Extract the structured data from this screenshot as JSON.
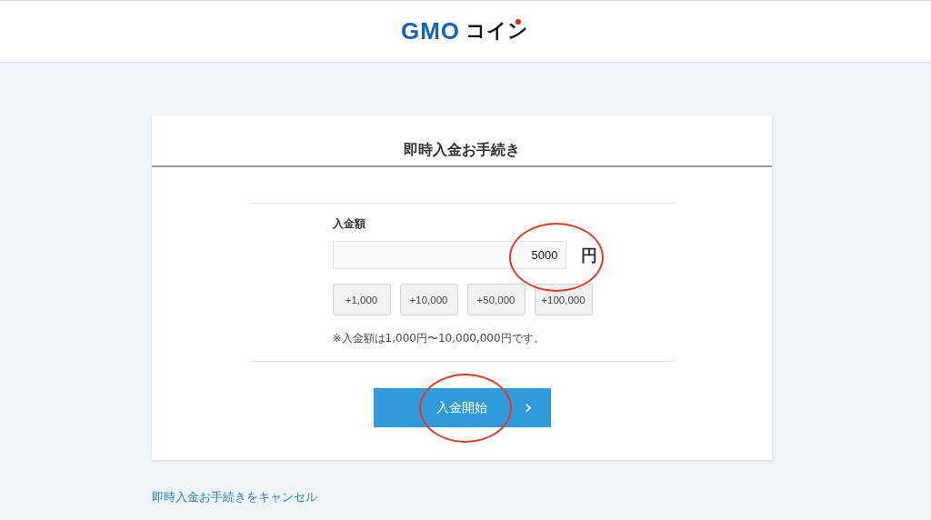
{
  "header": {
    "logo": {
      "latin": "GMO",
      "kana": "コイン"
    }
  },
  "card": {
    "title": "即時入金お手続き",
    "amount": {
      "label": "入金額",
      "value": "5000",
      "unit": "円"
    },
    "quick_buttons": [
      "+1,000",
      "+10,000",
      "+50,000",
      "+100,000"
    ],
    "note": "※入金額は1,000円〜10,000,000円です。",
    "submit": {
      "label": "入金開始",
      "chevron": "›"
    }
  },
  "cancel_link": "即時入金お手続きをキャンセル"
}
